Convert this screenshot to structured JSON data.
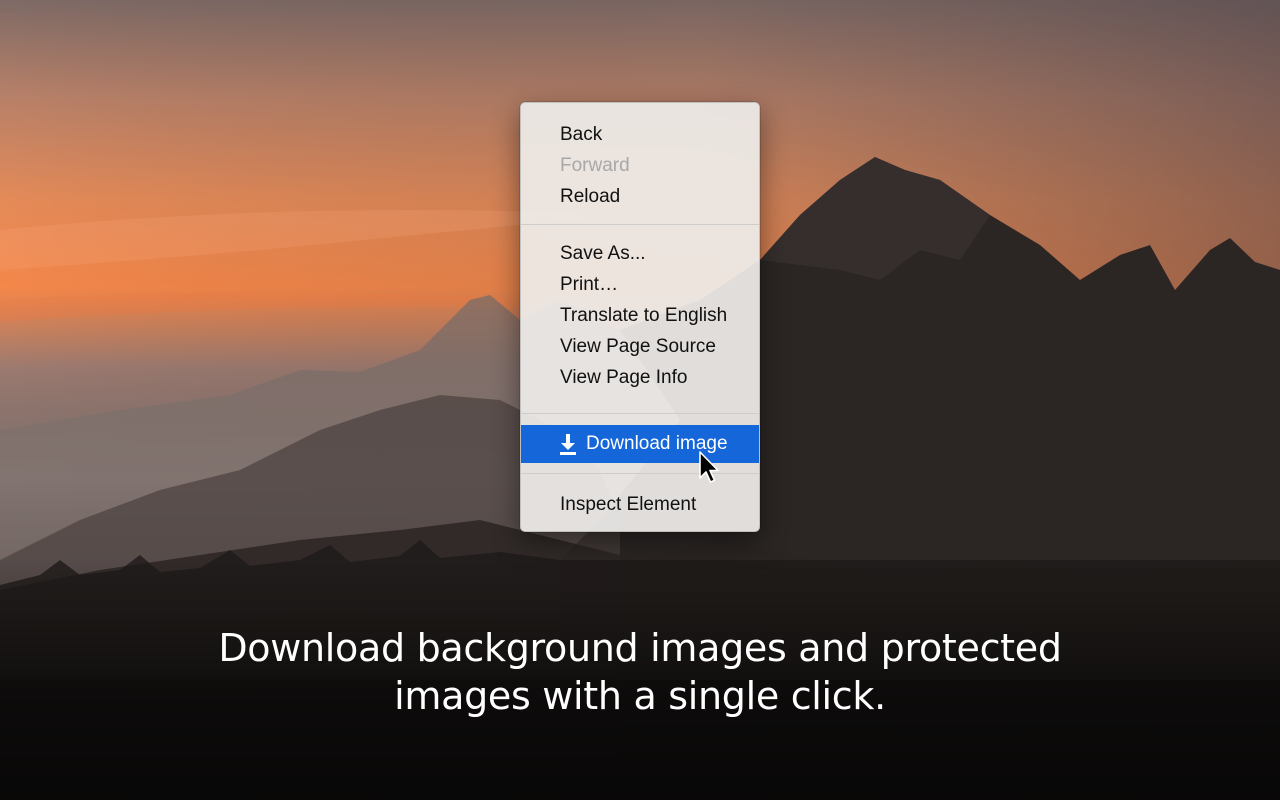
{
  "background": {
    "sky_colors": [
      "#7a6a66",
      "#c98a68",
      "#f08a4e",
      "#9a7c72"
    ],
    "mountain_color": "#2a2624"
  },
  "context_menu": {
    "items_group1": [
      {
        "label": "Back",
        "enabled": true
      },
      {
        "label": "Forward",
        "enabled": false
      },
      {
        "label": "Reload",
        "enabled": true
      }
    ],
    "items_group2": [
      {
        "label": "Save As..."
      },
      {
        "label": "Print…"
      },
      {
        "label": "Translate to English"
      },
      {
        "label": "View Page Source"
      },
      {
        "label": "View Page Info"
      }
    ],
    "download": {
      "label": "Download image",
      "icon": "download-icon",
      "highlight_color": "#1566d8"
    },
    "items_group3": [
      {
        "label": "Inspect Element"
      }
    ]
  },
  "caption": {
    "line1": "Download background images and protected",
    "line2": "images with a single click."
  }
}
